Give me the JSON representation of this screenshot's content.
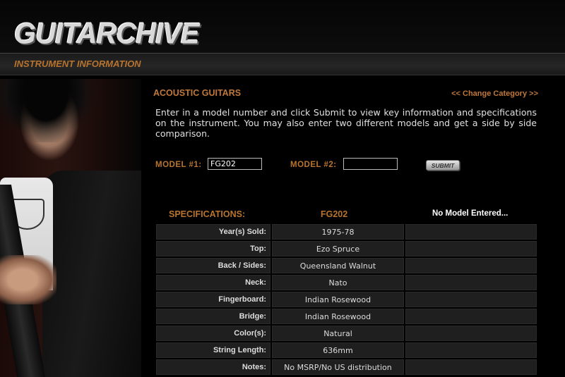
{
  "header": {
    "logo": "GUITARCHIVE",
    "subtitle": "INSTRUMENT INFORMATION"
  },
  "category": {
    "title": "ACOUSTIC GUITARS",
    "change_link": "<< Change Category >>"
  },
  "intro": "Enter in a model number and click Submit to view key information and specifications on the instrument. You may also enter two different models and get a side by side comparison.",
  "form": {
    "model1_label": "MODEL #1:",
    "model1_value": "FG202",
    "model2_label": "MODEL #2:",
    "model2_value": "",
    "submit_label": "SUBMIT"
  },
  "specs": {
    "header": "SPECIFICATIONS:",
    "model1_name": "FG202",
    "model2_name": "No Model Entered...",
    "rows": [
      {
        "label": "Year(s) Sold:",
        "v1": "1975-78",
        "v2": ""
      },
      {
        "label": "Top:",
        "v1": "Ezo Spruce",
        "v2": ""
      },
      {
        "label": "Back / Sides:",
        "v1": "Queensland Walnut",
        "v2": ""
      },
      {
        "label": "Neck:",
        "v1": "Nato",
        "v2": ""
      },
      {
        "label": "Fingerboard:",
        "v1": "Indian Rosewood",
        "v2": ""
      },
      {
        "label": "Bridge:",
        "v1": "Indian Rosewood",
        "v2": ""
      },
      {
        "label": "Color(s):",
        "v1": "Natural",
        "v2": ""
      },
      {
        "label": "String Length:",
        "v1": "636mm",
        "v2": ""
      },
      {
        "label": "Notes:",
        "v1": "No MSRP/No US distribution",
        "v2": ""
      }
    ]
  },
  "colors": {
    "accent": "#c0783a",
    "background": "#000000",
    "cell": "#1f1f1f"
  }
}
